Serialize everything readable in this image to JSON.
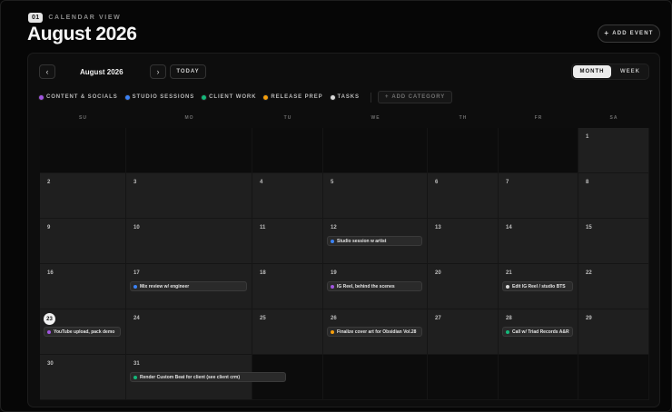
{
  "header": {
    "badge": "01",
    "view_label": "CALENDAR VIEW",
    "title": "August 2026",
    "add_event_label": "ADD EVENT"
  },
  "toolbar": {
    "month_label": "August 2026",
    "today_label": "TODAY",
    "prev_icon": "chevron-left-icon",
    "next_icon": "chevron-right-icon",
    "view_options": [
      {
        "label": "MONTH",
        "active": true
      },
      {
        "label": "WEEK",
        "active": false
      }
    ]
  },
  "categories": [
    {
      "label": "CONTENT & SOCIALS",
      "color": "#a155e0"
    },
    {
      "label": "STUDIO SESSIONS",
      "color": "#3b82f6"
    },
    {
      "label": "CLIENT WORK",
      "color": "#14b87a"
    },
    {
      "label": "RELEASE PREP",
      "color": "#f59e0b"
    },
    {
      "label": "TASKS",
      "color": "#d9d9d9"
    }
  ],
  "add_category_label": "ADD CATEGORY",
  "weekdays": [
    "SU",
    "MO",
    "TU",
    "WE",
    "TH",
    "FR",
    "SA"
  ],
  "weeks": [
    [
      null,
      null,
      null,
      null,
      null,
      null,
      1
    ],
    [
      2,
      3,
      4,
      5,
      6,
      7,
      8
    ],
    [
      9,
      10,
      11,
      12,
      13,
      14,
      15
    ],
    [
      16,
      17,
      18,
      19,
      20,
      21,
      22
    ],
    [
      23,
      24,
      25,
      26,
      27,
      28,
      29
    ],
    [
      30,
      31,
      null,
      null,
      null,
      null,
      null
    ]
  ],
  "today": 23,
  "events": [
    {
      "day": 12,
      "title": "Studio session w artist",
      "color": "#3b82f6"
    },
    {
      "day": 17,
      "title": "Mix review w/ engineer",
      "color": "#3b82f6"
    },
    {
      "day": 19,
      "title": "IG Reel, behind the scenes",
      "color": "#a155e0"
    },
    {
      "day": 21,
      "title": "Edit IG Reel / studio BTS",
      "color": "#d9d9d9"
    },
    {
      "day": 23,
      "title": "YouTube upload, pack demo",
      "color": "#a155e0"
    },
    {
      "day": 26,
      "title": "Finalize cover art for Obsidian Vol.28",
      "color": "#f59e0b"
    },
    {
      "day": 28,
      "title": "Call w/ Triad Records A&R",
      "color": "#14b87a"
    },
    {
      "day": 31,
      "title": "Render Custom Beat for client (see client crm)",
      "color": "#14b87a"
    }
  ]
}
